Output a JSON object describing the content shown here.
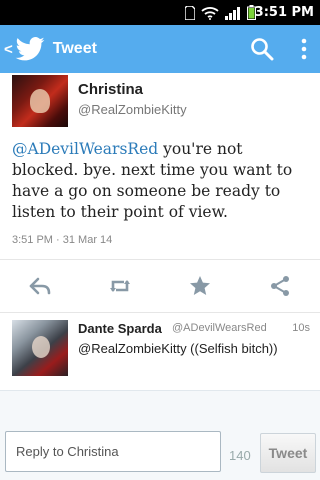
{
  "status_bar": {
    "time": "3:51 PM"
  },
  "action_bar": {
    "title": "Tweet",
    "icons": [
      "back-chevron-icon",
      "twitter-bird-icon",
      "search-icon",
      "overflow-menu-icon"
    ]
  },
  "tweet": {
    "author_name": "Christina",
    "author_handle": "@RealZombieKitty",
    "mention": "@ADevilWearsRed",
    "body": " you're not blocked. bye. next time you want to have a go on someone be ready to listen to their point of view.",
    "timestamp": "3:51 PM · 31 Mar 14",
    "actions": [
      "reply-icon",
      "retweet-icon",
      "favorite-star-icon",
      "share-icon"
    ]
  },
  "reply": {
    "name": "Dante Sparda",
    "handle": "@ADevilWearsRed",
    "time": "10s",
    "text": "@RealZombieKitty ((Selfish bitch))"
  },
  "composer": {
    "placeholder": "Reply to Christina",
    "char_count": "140",
    "button_label": "Tweet"
  },
  "colors": {
    "twitter_blue": "#55acee",
    "link_blue": "#2b7bb9"
  }
}
